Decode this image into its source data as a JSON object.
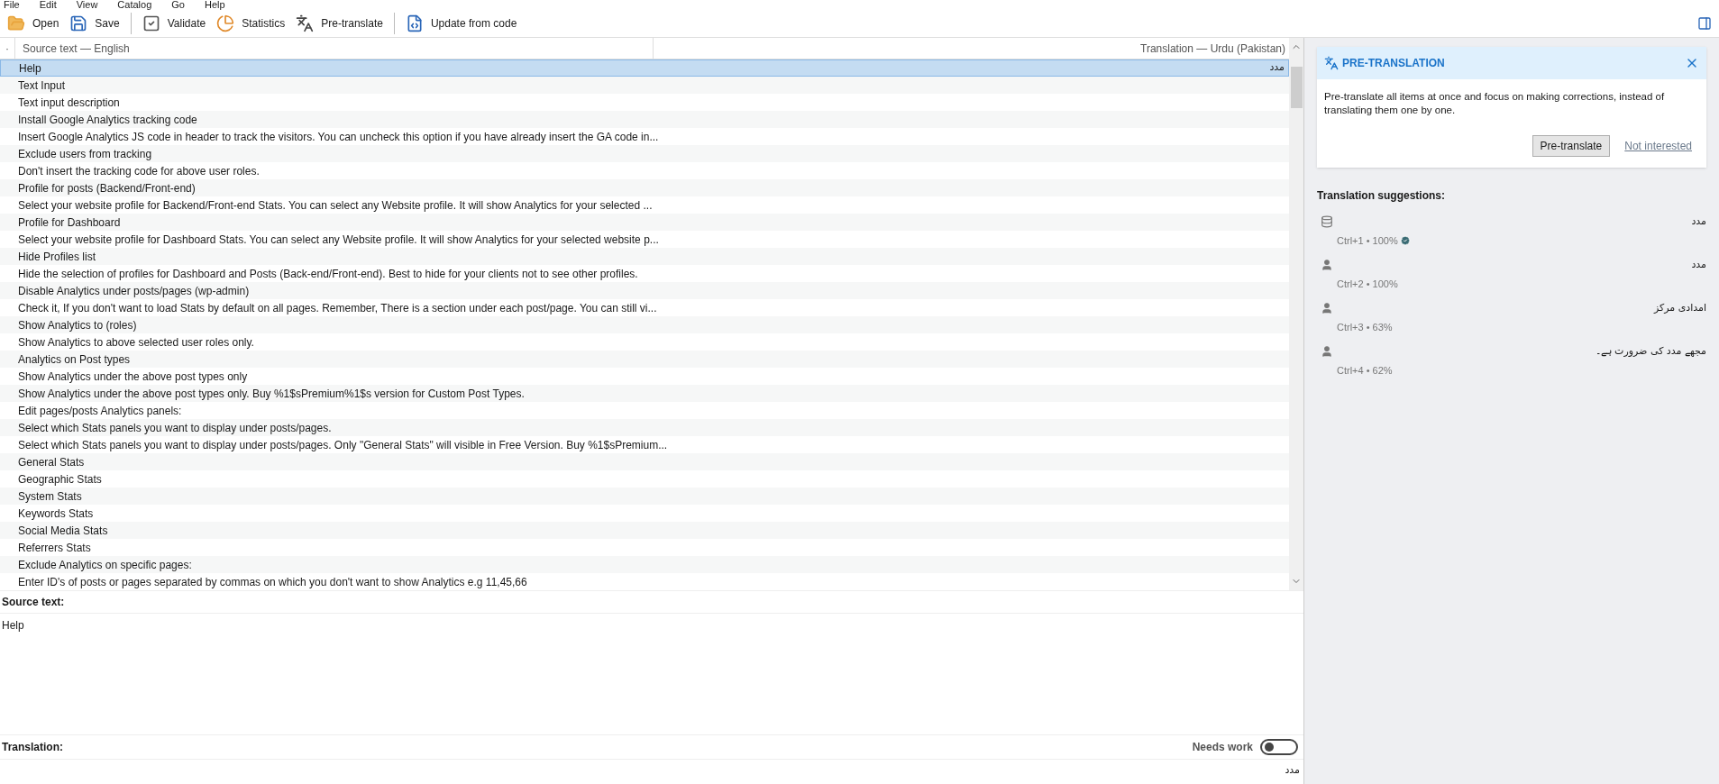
{
  "menu": [
    "File",
    "Edit",
    "View",
    "Catalog",
    "Go",
    "Help"
  ],
  "toolbar": [
    {
      "kind": "open",
      "label": "Open"
    },
    {
      "kind": "save",
      "label": "Save"
    },
    {
      "kind": "sep"
    },
    {
      "kind": "validate",
      "label": "Validate"
    },
    {
      "kind": "stats",
      "label": "Statistics"
    },
    {
      "kind": "pretranslate",
      "label": "Pre-translate"
    },
    {
      "kind": "sep"
    },
    {
      "kind": "update",
      "label": "Update from code"
    }
  ],
  "list": {
    "marker": "·",
    "columns": [
      "Source text — English",
      "Translation — Urdu (Pakistan)"
    ],
    "rows": [
      {
        "source": "Help",
        "translation": "مدد",
        "selected": true
      },
      {
        "source": "Text Input",
        "selected": false
      },
      {
        "source": "Text input description",
        "selected": false
      },
      {
        "source": "Install Google Analytics tracking code",
        "selected": false
      },
      {
        "source": "Insert Google Analytics JS code in header to track the visitors. You can uncheck this option if you have already insert the GA code in...",
        "selected": false
      },
      {
        "source": "Exclude users from tracking",
        "selected": false
      },
      {
        "source": "Don't insert the tracking code for above user roles.",
        "selected": false
      },
      {
        "source": "Profile for posts (Backend/Front-end)",
        "selected": false
      },
      {
        "source": "Select your website profile for Backend/Front-end Stats. You can select any Website profile. It will show Analytics for your selected ...",
        "selected": false
      },
      {
        "source": "Profile for Dashboard",
        "selected": false
      },
      {
        "source": "Select your website profile for Dashboard Stats. You can select any Website profile. It will show Analytics for your selected website p...",
        "selected": false
      },
      {
        "source": "Hide Profiles list",
        "selected": false
      },
      {
        "source": "Hide the selection of profiles for Dashboard and Posts (Back-end/Front-end). Best to hide for your clients not to see other profiles.",
        "selected": false
      },
      {
        "source": "Disable Analytics under posts/pages (wp-admin)",
        "selected": false
      },
      {
        "source": "Check it, If you don't want to load Stats by default on all pages. Remember, There is a section under each post/page. You can still vi...",
        "selected": false
      },
      {
        "source": "Show Analytics to (roles)",
        "selected": false
      },
      {
        "source": "Show Analytics to above selected user roles only.",
        "selected": false
      },
      {
        "source": "Analytics on Post types",
        "selected": false
      },
      {
        "source": "Show Analytics under the above post types only",
        "selected": false
      },
      {
        "source": "Show Analytics under the above post types only. Buy %1$sPremium%1$s version for Custom Post Types.",
        "selected": false
      },
      {
        "source": "Edit pages/posts Analytics panels:",
        "selected": false
      },
      {
        "source": "Select which Stats panels you want to display under posts/pages.",
        "selected": false
      },
      {
        "source": "Select which Stats panels you want to display under posts/pages. Only \"General Stats\" will visible in Free Version. Buy %1$sPremium...",
        "selected": false
      },
      {
        "source": "General Stats",
        "selected": false
      },
      {
        "source": "Geographic Stats",
        "selected": false
      },
      {
        "source": "System Stats",
        "selected": false
      },
      {
        "source": "Keywords Stats",
        "selected": false
      },
      {
        "source": "Social Media Stats",
        "selected": false
      },
      {
        "source": "Referrers Stats",
        "selected": false
      },
      {
        "source": "Exclude Analytics on specific pages:",
        "selected": false
      },
      {
        "source": "Enter ID's of posts or pages separated by commas on which you don't want to show Analytics e.g 11,45,66",
        "selected": false
      }
    ]
  },
  "source_panel": {
    "label": "Source text:",
    "text": "Help"
  },
  "translation_panel": {
    "label": "Translation:",
    "needs_work_label": "Needs work",
    "needs_work": false,
    "text": "مدد"
  },
  "pretranslation": {
    "title": "PRE-TRANSLATION",
    "body": "Pre-translate all items at once and focus on making corrections, instead of translating them one by one.",
    "button": "Pre-translate",
    "link": "Not interested"
  },
  "suggestions": {
    "title": "Translation suggestions:",
    "items": [
      {
        "kind": "memory",
        "text": "مدد",
        "meta": "Ctrl+1 • 100%",
        "verified": true
      },
      {
        "kind": "user",
        "text": "مدد",
        "meta": "Ctrl+2 • 100%",
        "verified": false
      },
      {
        "kind": "user",
        "text": "امدادی مرکز",
        "meta": "Ctrl+3 • 63%",
        "verified": false
      },
      {
        "kind": "user",
        "text": "مجھے مدد کی ضرورت ہے۔",
        "meta": "Ctrl+4 • 62%",
        "verified": false
      }
    ]
  }
}
